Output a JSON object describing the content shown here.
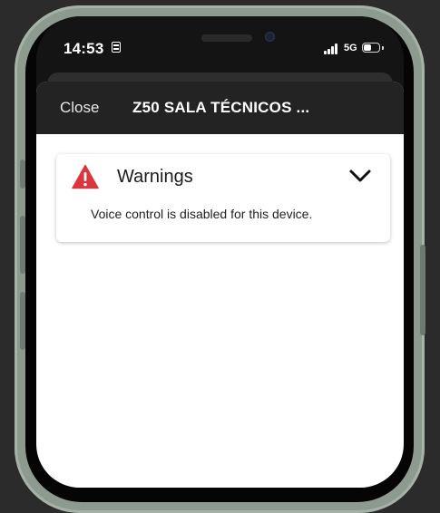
{
  "status_bar": {
    "time": "14:53",
    "network": "5G",
    "battery_level": 0.55,
    "icons": [
      "contact-card-icon",
      "signal-icon",
      "battery-icon"
    ]
  },
  "header": {
    "close_label": "Close",
    "title": "Z50 SALA TÉCNICOS ..."
  },
  "warning_card": {
    "icon": "warning-triangle-icon",
    "title": "Warnings",
    "message": "Voice control is disabled for this device.",
    "expand_icon": "chevron-down-icon"
  },
  "colors": {
    "warning_red": "#d9363e",
    "header_bg": "#232323",
    "frame": "#8c9a8f"
  }
}
